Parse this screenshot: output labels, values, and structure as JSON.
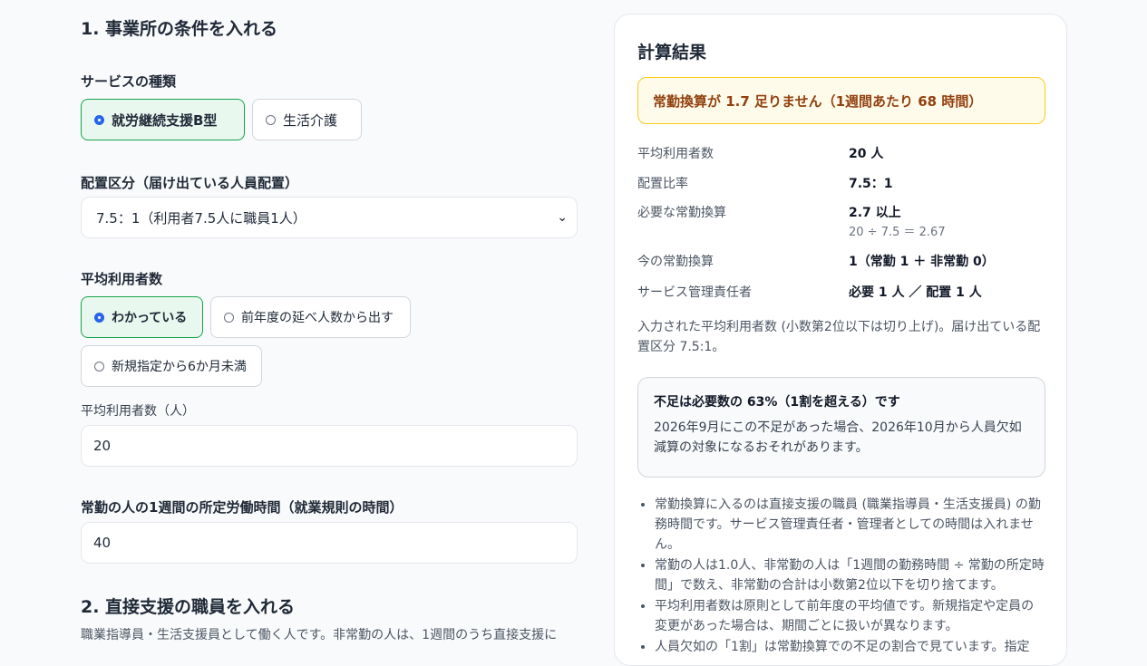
{
  "step1": {
    "title": "1. 事業所の条件を入れる",
    "service": {
      "label": "サービスの種類",
      "options": [
        "就労継続支援B型",
        "生活介護"
      ],
      "selected": "就労継続支援B型"
    },
    "placement": {
      "label": "配置区分（届け出ている人員配置）",
      "value": "7.5：1（利用者7.5人に職員1人）"
    },
    "avg_users": {
      "label": "平均利用者数",
      "options": [
        "わかっている",
        "前年度の延べ人数から出す",
        "新規指定から6か月未満"
      ],
      "selected": "わかっている",
      "input_label": "平均利用者数（人）",
      "input_value": "20"
    },
    "hours": {
      "label": "常勤の人の1週間の所定労働時間（就業規則の時間）",
      "value": "40"
    }
  },
  "step2": {
    "title": "2. 直接支援の職員を入れる",
    "description": "職業指導員・生活支援員として働く人です。非常勤の人は、1週間のうち直接支援に"
  },
  "result": {
    "title": "計算結果",
    "alert": "常勤換算が 1.7 足りません（1週間あたり 68 時間）",
    "rows": [
      {
        "label": "平均利用者数",
        "value": "20 人"
      },
      {
        "label": "配置比率",
        "value": "7.5：1"
      },
      {
        "label": "必要な常勤換算",
        "value": "2.7 以上",
        "formula": "20 ÷ 7.5 ＝ 2.67"
      },
      {
        "label": "今の常勤換算",
        "value": "1（常勤 1 ＋ 非常勤 0）"
      },
      {
        "label": "サービス管理責任者",
        "value": "必要 1 人 ／ 配置 1 人"
      }
    ],
    "note": "入力された平均利用者数 (小数第2位以下は切り上げ)。届け出ている配置区分 7.5:1。",
    "callout": {
      "title": "不足は必要数の 63%（1割を超える）です",
      "body": "2026年9月にこの不足があった場合、2026年10月から人員欠如減算の対象になるおそれがあります。"
    },
    "bullets": [
      "常勤換算に入るのは直接支援の職員 (職業指導員・生活支援員) の勤務時間です。サービス管理責任者・管理者としての時間は入れません。",
      "常勤の人は1.0人、非常勤の人は「1週間の勤務時間 ÷ 常勤の所定時間」で数え、非常勤の合計は小数第2位以下を切り捨てます。",
      "平均利用者数は原則として前年度の平均値です。新規指定や定員の変更があった場合は、期間ごとに扱いが異なります。",
      "人員欠如の「1割」は常勤換算での不足の割合で見ています。指定"
    ]
  },
  "colors": {
    "selected_bg": "#e9f8ee",
    "selected_border": "#16a34a",
    "radio_accent": "#2563eb",
    "alert_bg": "#fffbeb",
    "alert_border": "#facc15",
    "alert_text": "#92400e"
  }
}
